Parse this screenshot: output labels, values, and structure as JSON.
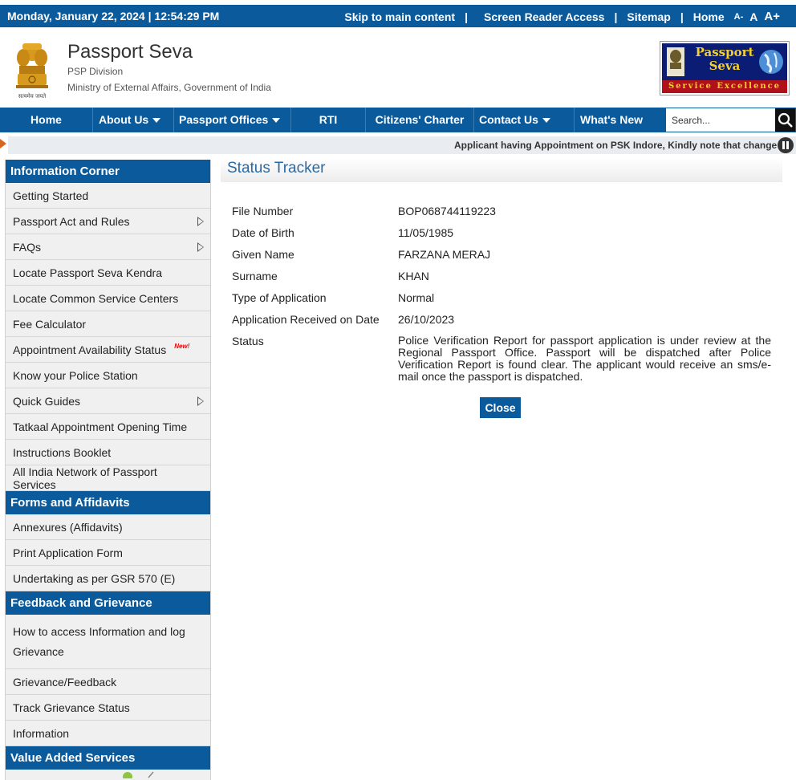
{
  "topbar": {
    "datetime": "Monday,  January  22, 2024 | 12:54:29 PM",
    "skip": "Skip to main content",
    "screen_reader": "Screen Reader Access",
    "sitemap": "Sitemap",
    "home": "Home",
    "font_small": "A-",
    "font_normal": "A",
    "font_large": "A+",
    "separator": "|"
  },
  "header": {
    "title": "Passport Seva",
    "division": "PSP Division",
    "ministry": "Ministry of External Affairs, Government of India",
    "emblem_caption": "सत्यमेव जयते",
    "logo_line1": "Passport",
    "logo_line2": "Seva",
    "logo_band": "Service Excellence"
  },
  "nav": {
    "items": [
      {
        "label": "Home",
        "dropdown": false
      },
      {
        "label": "About Us",
        "dropdown": true
      },
      {
        "label": "Passport Offices",
        "dropdown": true
      },
      {
        "label": "RTI",
        "dropdown": false
      },
      {
        "label": "Citizens' Charter",
        "dropdown": false
      },
      {
        "label": "Contact Us",
        "dropdown": true
      },
      {
        "label": "What's New",
        "dropdown": false
      }
    ],
    "search_placeholder": "Search..."
  },
  "marquee": {
    "text": "Applicant having Appointment on PSK Indore, Kindly note that change"
  },
  "sidebar": {
    "info_corner": {
      "heading": "Information Corner",
      "items": [
        "Getting Started",
        "Passport Act and Rules",
        "FAQs",
        "Locate Passport Seva Kendra",
        "Locate Common Service Centers",
        "Fee Calculator",
        "Appointment Availability Status",
        "Know your Police Station",
        "Quick Guides",
        "Tatkaal Appointment Opening Time",
        "Instructions Booklet",
        "All India Network of Passport Services"
      ],
      "new_badge": "New!"
    },
    "forms": {
      "heading": "Forms and Affidavits",
      "items": [
        "Annexures (Affidavits)",
        "Print Application Form",
        "Undertaking as per GSR 570 (E)"
      ]
    },
    "feedback": {
      "heading": "Feedback and Grievance",
      "items": [
        "How to access Information and log Grievance",
        "Grievance/Feedback",
        "Track Grievance Status",
        "Information"
      ]
    },
    "value_added": {
      "heading": "Value Added Services"
    }
  },
  "main": {
    "title": "Status Tracker",
    "fields": {
      "file_number_label": "File Number",
      "file_number": "BOP068744119223",
      "dob_label": "Date of Birth",
      "dob": "11/05/1985",
      "given_name_label": "Given Name",
      "given_name": "FARZANA MERAJ",
      "surname_label": "Surname",
      "surname": "KHAN",
      "type_label": "Type of Application",
      "type": "Normal",
      "received_label": "Application Received on Date",
      "received": "26/10/2023",
      "status_label": "Status",
      "status": "Police Verification Report for passport application is under review at the Regional Passport Office. Passport will be dispatched after Police Verification Report is found clear. The applicant would receive an sms/e-mail once the passport is dispatched."
    },
    "close_label": "Close"
  }
}
